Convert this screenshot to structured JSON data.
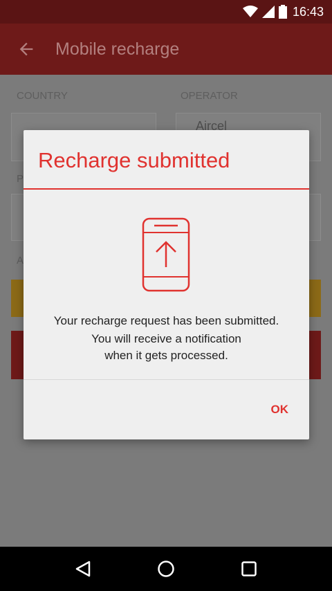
{
  "status_bar": {
    "time": "16:43",
    "icons": [
      "wifi-icon",
      "signal-icon",
      "battery-icon"
    ]
  },
  "app_bar": {
    "title": "Mobile recharge",
    "back_icon": "arrow-left-icon"
  },
  "form": {
    "country_label": "COUNTRY",
    "operator_label": "OPERATOR",
    "operator_value": "Aircel",
    "phone_label": "P",
    "amount_label": "A"
  },
  "dialog": {
    "title": "Recharge submitted",
    "icon": "phone-upload-icon",
    "message_line1": "Your recharge request has been submitted.",
    "message_line2": "You will receive a notification",
    "message_line3": "when it gets processed.",
    "ok_label": "OK"
  },
  "nav_bar": {
    "back": "nav-back-icon",
    "home": "nav-home-icon",
    "recents": "nav-recents-icon"
  },
  "colors": {
    "accent": "#e0322f",
    "app_bar_dim": "#6e1a19",
    "status_bar_dim": "#5a1414"
  }
}
